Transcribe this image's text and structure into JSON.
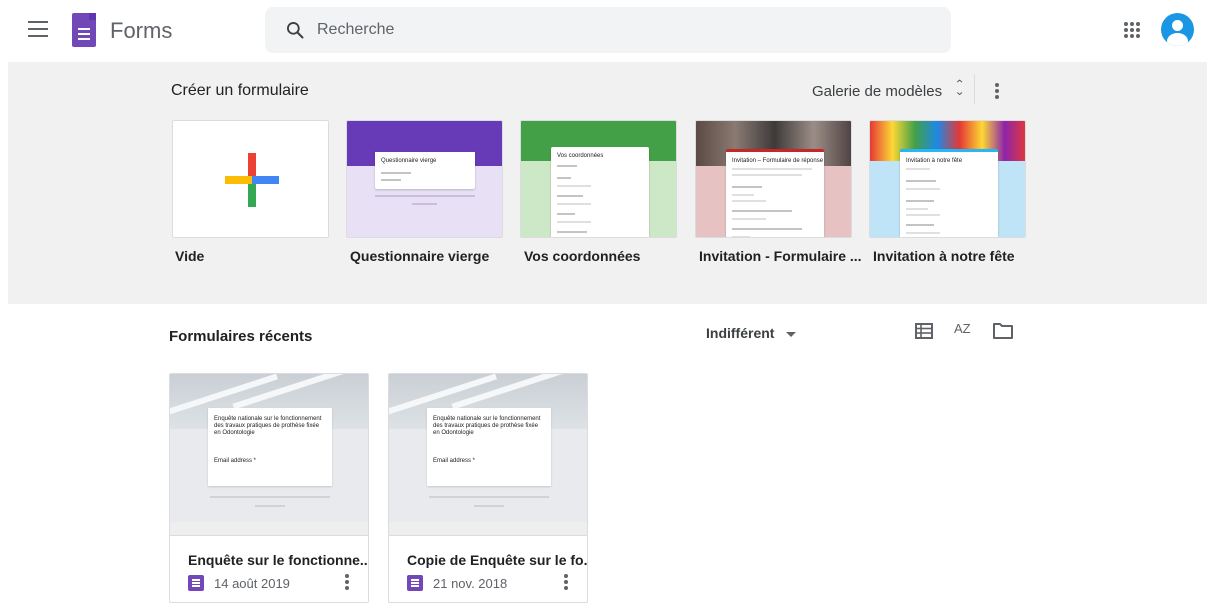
{
  "header": {
    "app_title": "Forms",
    "search_placeholder": "Recherche",
    "icons": [
      "menu-icon",
      "forms-logo-icon",
      "search-icon",
      "apps-grid-icon",
      "account-avatar-icon"
    ]
  },
  "gallery": {
    "title": "Créer un formulaire",
    "toggle_label": "Galerie de modèles",
    "templates": [
      {
        "label": "Vide"
      },
      {
        "label": "Questionnaire vierge",
        "preview_title": "Questionnaire vierge"
      },
      {
        "label": "Vos coordonnées",
        "preview_title": "Vos coordonnées"
      },
      {
        "label": "Invitation - Formulaire ...",
        "preview_title": "Invitation – Formulaire de réponse"
      },
      {
        "label": "Invitation à notre fête",
        "preview_title": "Invitation à notre fête"
      }
    ]
  },
  "recent": {
    "title": "Formulaires récents",
    "owner_filter": "Indifférent",
    "sort_label": "AZ",
    "docs": [
      {
        "title": "Enquête sur le fonctionne...",
        "date": "14 août 2019",
        "preview_text": "Enquête nationale sur le fonctionnement des travaux pratiques de prothèse fixée en Odontologie",
        "preview_field": "Email address *"
      },
      {
        "title": "Copie de Enquête sur le fo...",
        "date": "21 nov. 2018",
        "preview_text": "Enquête nationale sur le fonctionnement des travaux pratiques de prothèse fixée en Odontologie",
        "preview_field": "Email address *"
      }
    ]
  },
  "colors": {
    "forms_purple": "#7248b9",
    "gallery_bg": "#f1f1f1",
    "avatar_blue": "#1a96e3"
  }
}
